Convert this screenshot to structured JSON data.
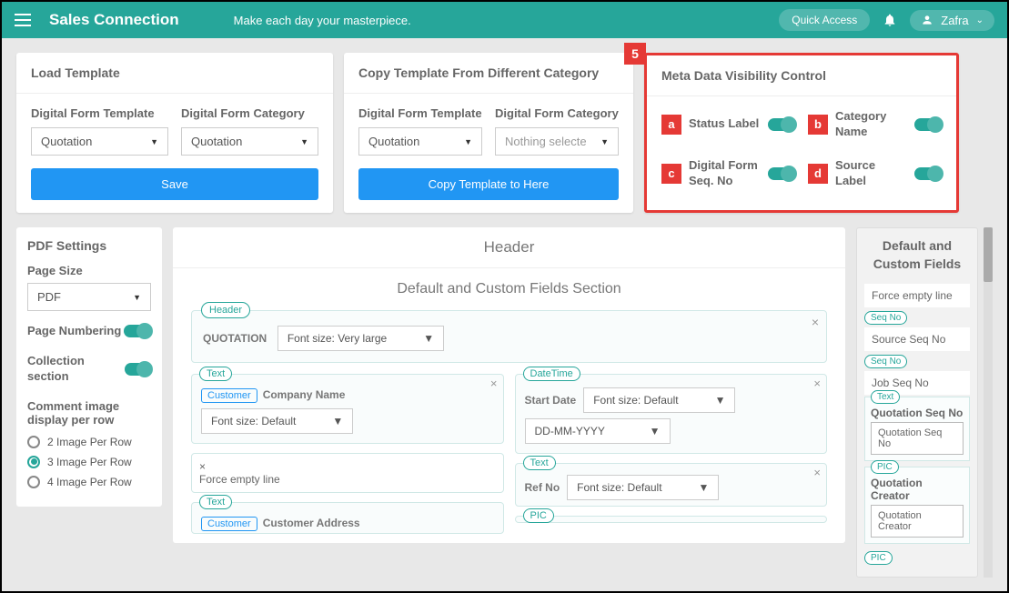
{
  "topbar": {
    "brand": "Sales Connection",
    "tagline": "Make each day your masterpiece.",
    "quick_access": "Quick Access",
    "user": "Zafra"
  },
  "load_template": {
    "title": "Load Template",
    "template_label": "Digital Form Template",
    "template_value": "Quotation",
    "category_label": "Digital Form Category",
    "category_value": "Quotation",
    "save_btn": "Save"
  },
  "copy_template": {
    "title": "Copy Template From Different Category",
    "template_label": "Digital Form Template",
    "template_value": "Quotation",
    "category_label": "Digital Form Category",
    "category_placeholder": "Nothing selecte",
    "copy_btn": "Copy Template to Here"
  },
  "meta": {
    "title": "Meta Data Visibility Control",
    "items": [
      {
        "annot": "a",
        "label": "Status Label"
      },
      {
        "annot": "b",
        "label": "Category Name"
      },
      {
        "annot": "c",
        "label": "Digital Form Seq. No"
      },
      {
        "annot": "d",
        "label": "Source Label"
      }
    ],
    "badge5": "5"
  },
  "pdf": {
    "title": "PDF Settings",
    "page_size_label": "Page Size",
    "page_size_value": "PDF",
    "page_numbering": "Page Numbering",
    "collection_section": "Collection section",
    "comment_label": "Comment image display per row",
    "radio2": "2 Image Per Row",
    "radio3": "3 Image Per Row",
    "radio4": "4 Image Per Row"
  },
  "center": {
    "header": "Header",
    "section_title": "Default and Custom Fields Section",
    "header_tag": "Header",
    "quotation_label": "QUOTATION",
    "font_very_large": "Font size: Very large",
    "text_tag": "Text",
    "customer_tag": "Customer",
    "company_name": "Company Name",
    "font_default": "Font size: Default",
    "force_empty": "Force empty line",
    "customer_address": "Customer Address",
    "datetime_tag": "DateTime",
    "start_date": "Start Date",
    "date_format": "DD-MM-YYYY",
    "ref_no": "Ref No",
    "pic_tag": "PIC"
  },
  "right": {
    "title": "Default and Custom Fields",
    "force_empty": "Force empty line",
    "seq_no_tag": "Seq No",
    "source_seq": "Source Seq No",
    "job_seq": "Job Seq No",
    "text_tag": "Text",
    "quotation_seq": "Quotation Seq No",
    "pic_tag": "PIC",
    "quotation_creator": "Quotation Creator"
  }
}
